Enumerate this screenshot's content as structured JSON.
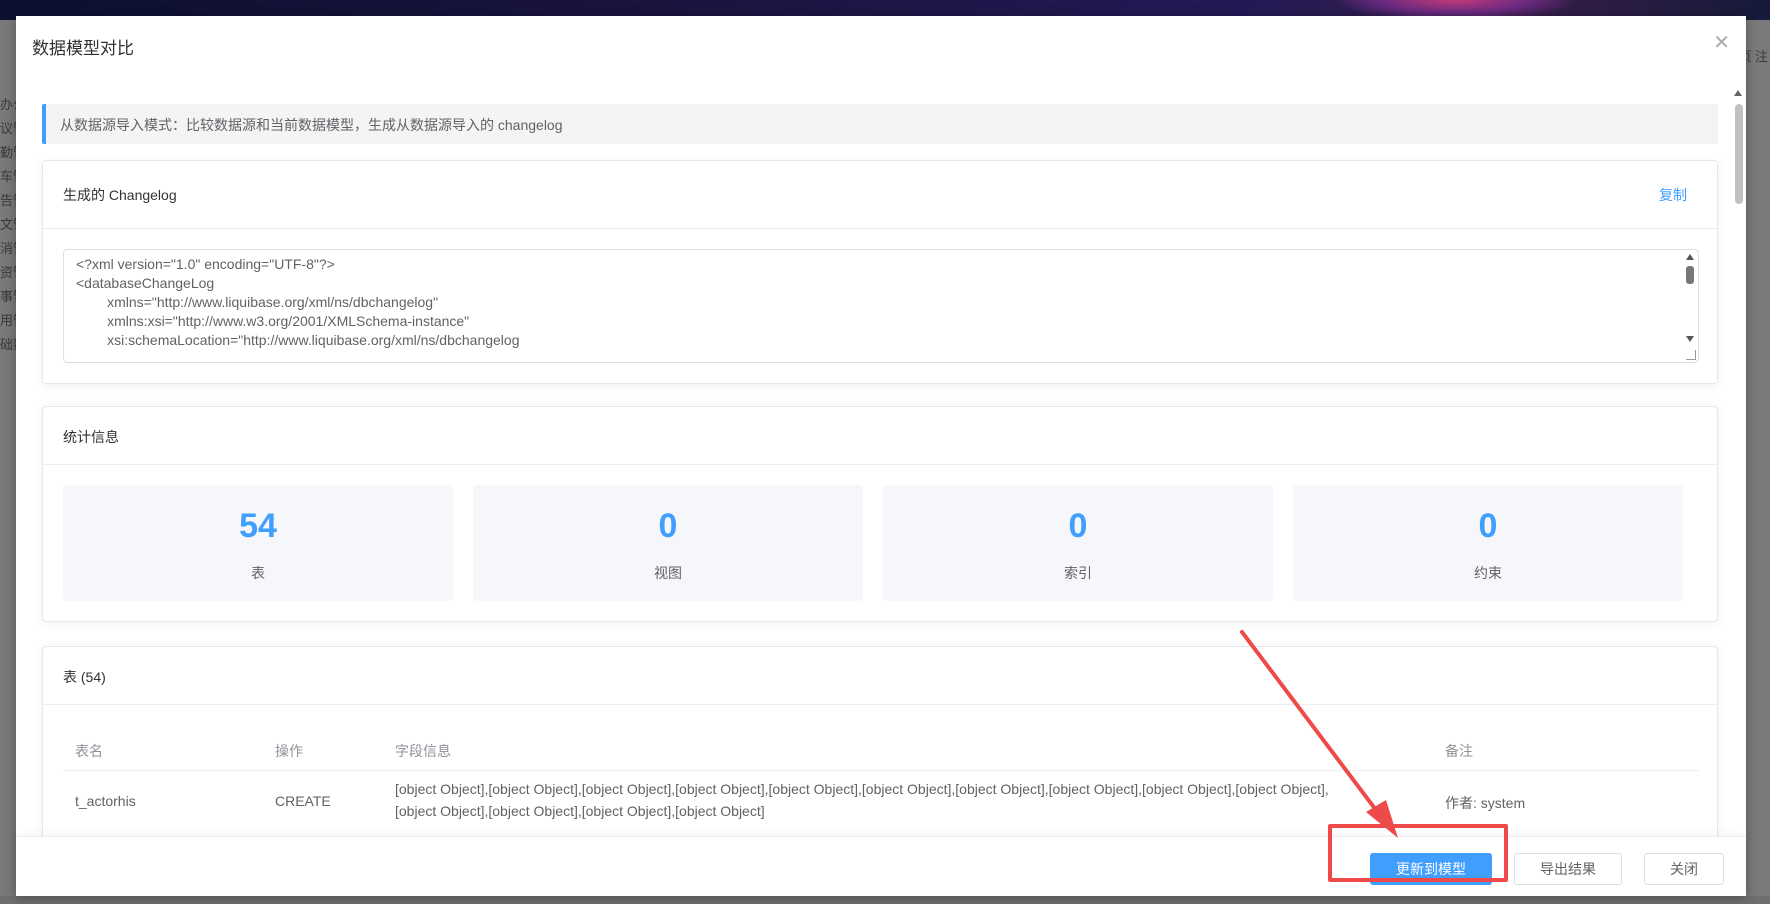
{
  "background": {
    "left_letters": [
      "办公",
      "议管",
      "勤管",
      "车管",
      "告管",
      "文管",
      "消管",
      "资管",
      "事管",
      "用管",
      "础数"
    ],
    "right_text": "页 注"
  },
  "dialog": {
    "title": "数据模型对比",
    "close_icon": "close-icon",
    "alert_text": "从数据源导入模式：比较数据源和当前数据模型，生成从数据源导入的 changelog"
  },
  "changelog": {
    "title": "生成的 Changelog",
    "copy_label": "复制",
    "lines": [
      "<?xml version=\"1.0\" encoding=\"UTF-8\"?>",
      "<databaseChangeLog",
      "        xmlns=\"http://www.liquibase.org/xml/ns/dbchangelog\"",
      "        xmlns:xsi=\"http://www.w3.org/2001/XMLSchema-instance\"",
      "        xsi:schemaLocation=\"http://www.liquibase.org/xml/ns/dbchangelog"
    ]
  },
  "stats": {
    "title": "统计信息",
    "items": [
      {
        "value": "54",
        "label": "表"
      },
      {
        "value": "0",
        "label": "视图"
      },
      {
        "value": "0",
        "label": "索引"
      },
      {
        "value": "0",
        "label": "约束"
      }
    ]
  },
  "tables": {
    "title": "表 (54)",
    "columns": [
      "表名",
      "操作",
      "字段信息",
      "备注"
    ],
    "rows": [
      {
        "name": "t_actorhis",
        "op": "CREATE",
        "fields_line1": "[object Object],[object Object],[object Object],[object Object],[object Object],[object Object],[object Object],[object Object],[object Object],[object Object],",
        "fields_line2": "[object Object],[object Object],[object Object],[object Object]",
        "note": "作者: system"
      }
    ]
  },
  "footer": {
    "update_label": "更新到模型",
    "export_label": "导出结果",
    "close_label": "关闭"
  },
  "colors": {
    "primary": "#409eff",
    "annotation_red": "#ee4a4a"
  }
}
